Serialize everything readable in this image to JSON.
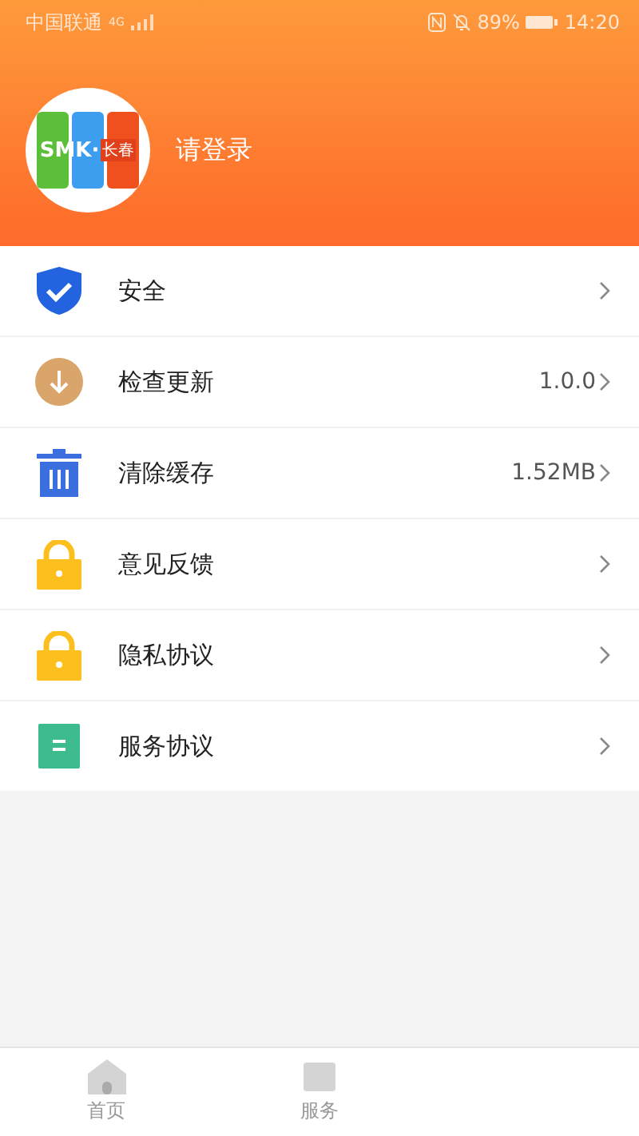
{
  "status_bar": {
    "carrier": "中国联通",
    "network": "4G",
    "battery": "89%",
    "time": "14:20"
  },
  "profile": {
    "logo_text": "SMK·",
    "logo_badge": "长春",
    "login_prompt": "请登录"
  },
  "menu": [
    {
      "kind": "shield",
      "label": "安全"
    },
    {
      "kind": "download",
      "label": "检查更新",
      "value": "1.0.0"
    },
    {
      "kind": "trash",
      "label": "清除缓存",
      "value": "1.52MB"
    },
    {
      "kind": "lock",
      "label": "意见反馈"
    },
    {
      "kind": "lock",
      "label": "隐私协议"
    },
    {
      "kind": "doc",
      "label": "服务协议"
    }
  ],
  "tab_bar": [
    {
      "kind": "home",
      "label": "首页"
    },
    {
      "kind": "service",
      "label": "服务"
    }
  ]
}
